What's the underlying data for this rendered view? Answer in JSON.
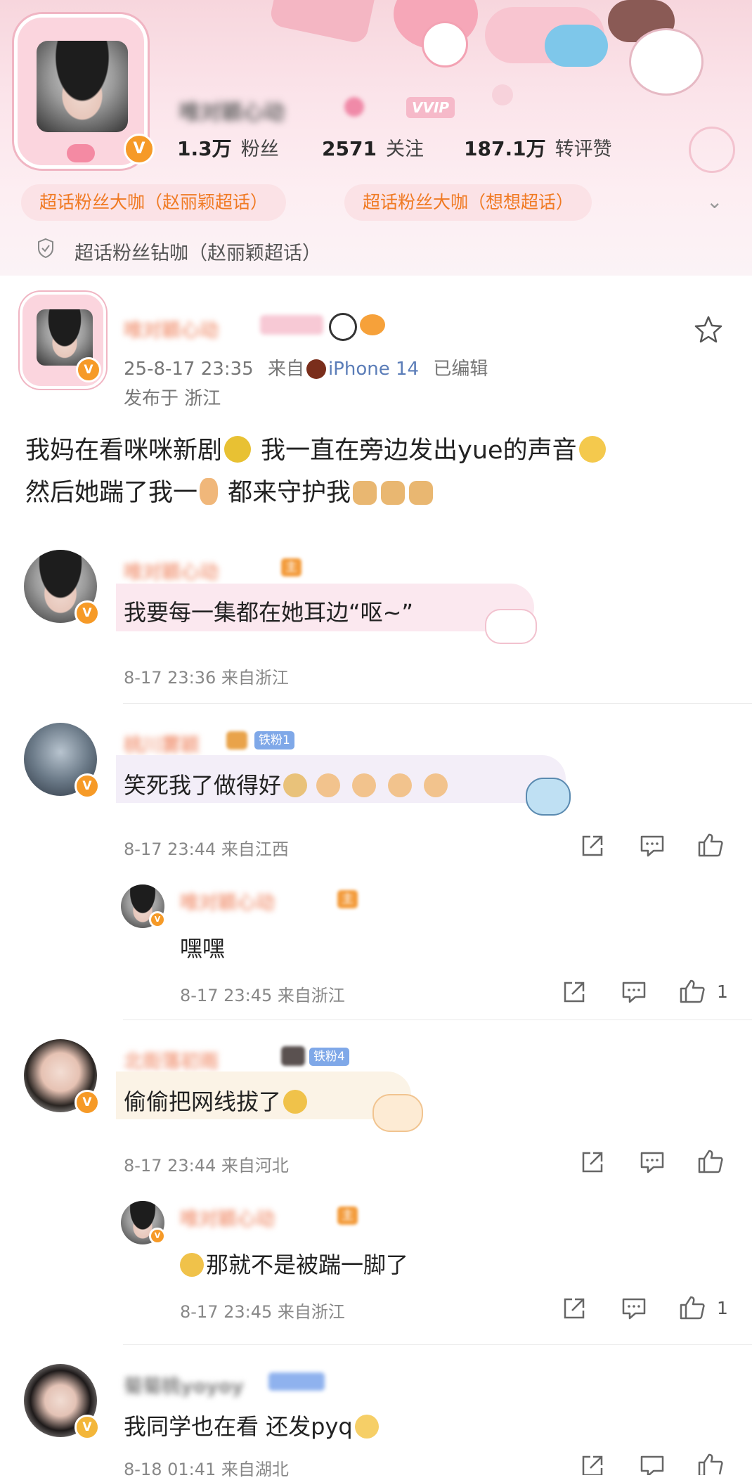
{
  "profile": {
    "name": "唯对颖心动",
    "vip_label": "VVIP",
    "stats": [
      {
        "num": "1.3万",
        "label": "粉丝"
      },
      {
        "num": "2571",
        "label": "关注"
      },
      {
        "num": "187.1万",
        "label": "转评赞"
      }
    ],
    "tags": [
      "超话粉丝大咖（赵丽颖超话）",
      "超话粉丝大咖（想想超话）"
    ],
    "diamond_tag": "超话粉丝钻咖（赵丽颖超话）"
  },
  "post": {
    "author": "唯对颖心动",
    "time": "25-8-17 23:35",
    "from_prefix": "来自",
    "device": "iPhone 14",
    "edited": "已编辑",
    "location": "发布于 浙江",
    "line1a": "我妈在看咪咪新剧",
    "line1b": " 我一直在旁边发出yue的声音",
    "line2a": "然后她踹了我一",
    "line2b": " 都来守护我"
  },
  "comments": [
    {
      "name": "唯对颖心动",
      "badge": "主",
      "text": "我要每一集都在她耳边“呕~”",
      "meta": "8-17 23:36  来自浙江"
    },
    {
      "name": "桃川雾颖",
      "badge": "铁粉1",
      "text": "笑死我了做得好",
      "meta": "8-17 23:44  来自江西",
      "reply": {
        "name": "唯对颖心动",
        "badge": "主",
        "text": "嘿嘿",
        "meta": "8-17 23:45  来自浙江",
        "likes": "1"
      }
    },
    {
      "name": "北街落初雨",
      "badge": "铁粉4",
      "text": "偷偷把网线拔了",
      "meta": "8-17 23:44  来自河北",
      "reply": {
        "name": "唯对颖心动",
        "badge": "主",
        "text": "那就不是被踹一脚了",
        "meta": "8-17 23:45  来自浙江",
        "likes": "1"
      }
    },
    {
      "name": "菊菊桃yoyoy",
      "badge": "",
      "text": "我同学也在看 还发pyq",
      "meta": "8-18 01:41  来自湖北"
    }
  ],
  "colors": {
    "accent": "#f69a27",
    "tag_text": "#f07a23",
    "link": "#5b7db8",
    "header_pink": "#f7d6dd"
  },
  "icons": [
    "star-icon",
    "share-icon",
    "comment-icon",
    "like-icon",
    "shield-icon",
    "chevron-down-icon",
    "verified-badge-icon"
  ]
}
